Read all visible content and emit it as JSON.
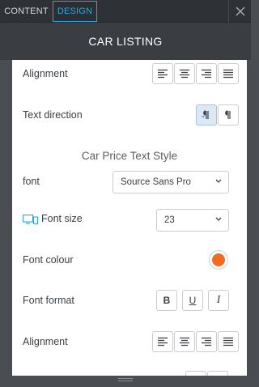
{
  "tabs": [
    {
      "label": "CONTENT",
      "active": false
    },
    {
      "label": "DESIGN",
      "active": true
    }
  ],
  "header": {
    "title": "CAR LISTING"
  },
  "rows": {
    "alignment_top": {
      "label": "Alignment"
    },
    "text_direction": {
      "label": "Text direction"
    },
    "section_title": "Car Price Text Style",
    "font": {
      "label": "font",
      "value": "Source Sans Pro"
    },
    "font_size": {
      "label": "Font size",
      "value": "23"
    },
    "font_colour": {
      "label": "Font colour",
      "color": "#f26b21"
    },
    "font_format": {
      "label": "Font format",
      "bold": "B",
      "underline": "U",
      "italic": "I"
    },
    "alignment_bottom": {
      "label": "Alignment"
    }
  },
  "icons": {
    "close": "close-icon",
    "align_left": "align-left-icon",
    "align_center": "align-center-icon",
    "align_right": "align-right-icon",
    "align_justify": "align-justify-icon",
    "ltr": "ltr-direction-icon",
    "rtl": "rtl-direction-icon",
    "device": "responsive-device-icon",
    "chevron": "chevron-down-icon"
  },
  "colors": {
    "accent": "#2aa6dd",
    "header_bg": "#3a3d42",
    "topbar_bg": "#2e3136",
    "swatch": "#f26b21"
  }
}
